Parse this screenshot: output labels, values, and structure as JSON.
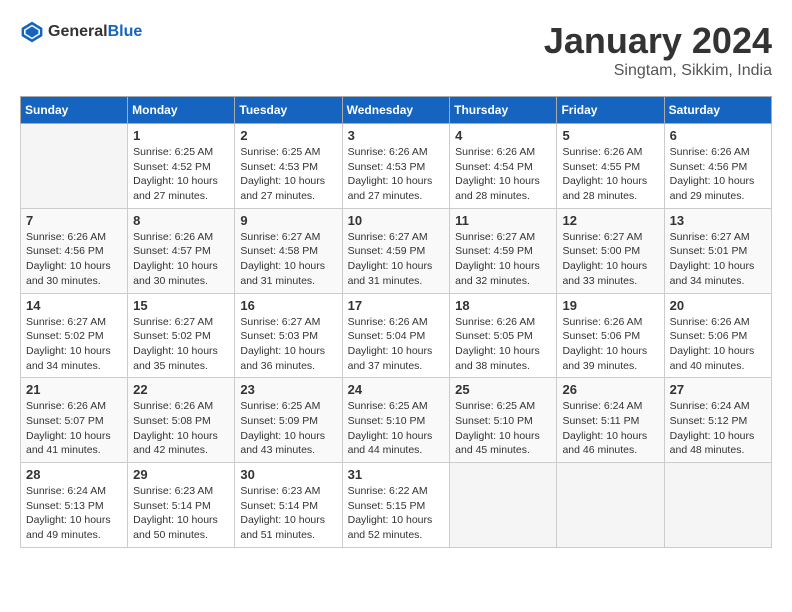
{
  "header": {
    "logo_general": "General",
    "logo_blue": "Blue",
    "month_year": "January 2024",
    "location": "Singtam, Sikkim, India"
  },
  "days_of_week": [
    "Sunday",
    "Monday",
    "Tuesday",
    "Wednesday",
    "Thursday",
    "Friday",
    "Saturday"
  ],
  "weeks": [
    [
      {
        "day": "",
        "info": ""
      },
      {
        "day": "1",
        "info": "Sunrise: 6:25 AM\nSunset: 4:52 PM\nDaylight: 10 hours\nand 27 minutes."
      },
      {
        "day": "2",
        "info": "Sunrise: 6:25 AM\nSunset: 4:53 PM\nDaylight: 10 hours\nand 27 minutes."
      },
      {
        "day": "3",
        "info": "Sunrise: 6:26 AM\nSunset: 4:53 PM\nDaylight: 10 hours\nand 27 minutes."
      },
      {
        "day": "4",
        "info": "Sunrise: 6:26 AM\nSunset: 4:54 PM\nDaylight: 10 hours\nand 28 minutes."
      },
      {
        "day": "5",
        "info": "Sunrise: 6:26 AM\nSunset: 4:55 PM\nDaylight: 10 hours\nand 28 minutes."
      },
      {
        "day": "6",
        "info": "Sunrise: 6:26 AM\nSunset: 4:56 PM\nDaylight: 10 hours\nand 29 minutes."
      }
    ],
    [
      {
        "day": "7",
        "info": "Sunrise: 6:26 AM\nSunset: 4:56 PM\nDaylight: 10 hours\nand 30 minutes."
      },
      {
        "day": "8",
        "info": "Sunrise: 6:26 AM\nSunset: 4:57 PM\nDaylight: 10 hours\nand 30 minutes."
      },
      {
        "day": "9",
        "info": "Sunrise: 6:27 AM\nSunset: 4:58 PM\nDaylight: 10 hours\nand 31 minutes."
      },
      {
        "day": "10",
        "info": "Sunrise: 6:27 AM\nSunset: 4:59 PM\nDaylight: 10 hours\nand 31 minutes."
      },
      {
        "day": "11",
        "info": "Sunrise: 6:27 AM\nSunset: 4:59 PM\nDaylight: 10 hours\nand 32 minutes."
      },
      {
        "day": "12",
        "info": "Sunrise: 6:27 AM\nSunset: 5:00 PM\nDaylight: 10 hours\nand 33 minutes."
      },
      {
        "day": "13",
        "info": "Sunrise: 6:27 AM\nSunset: 5:01 PM\nDaylight: 10 hours\nand 34 minutes."
      }
    ],
    [
      {
        "day": "14",
        "info": "Sunrise: 6:27 AM\nSunset: 5:02 PM\nDaylight: 10 hours\nand 34 minutes."
      },
      {
        "day": "15",
        "info": "Sunrise: 6:27 AM\nSunset: 5:02 PM\nDaylight: 10 hours\nand 35 minutes."
      },
      {
        "day": "16",
        "info": "Sunrise: 6:27 AM\nSunset: 5:03 PM\nDaylight: 10 hours\nand 36 minutes."
      },
      {
        "day": "17",
        "info": "Sunrise: 6:26 AM\nSunset: 5:04 PM\nDaylight: 10 hours\nand 37 minutes."
      },
      {
        "day": "18",
        "info": "Sunrise: 6:26 AM\nSunset: 5:05 PM\nDaylight: 10 hours\nand 38 minutes."
      },
      {
        "day": "19",
        "info": "Sunrise: 6:26 AM\nSunset: 5:06 PM\nDaylight: 10 hours\nand 39 minutes."
      },
      {
        "day": "20",
        "info": "Sunrise: 6:26 AM\nSunset: 5:06 PM\nDaylight: 10 hours\nand 40 minutes."
      }
    ],
    [
      {
        "day": "21",
        "info": "Sunrise: 6:26 AM\nSunset: 5:07 PM\nDaylight: 10 hours\nand 41 minutes."
      },
      {
        "day": "22",
        "info": "Sunrise: 6:26 AM\nSunset: 5:08 PM\nDaylight: 10 hours\nand 42 minutes."
      },
      {
        "day": "23",
        "info": "Sunrise: 6:25 AM\nSunset: 5:09 PM\nDaylight: 10 hours\nand 43 minutes."
      },
      {
        "day": "24",
        "info": "Sunrise: 6:25 AM\nSunset: 5:10 PM\nDaylight: 10 hours\nand 44 minutes."
      },
      {
        "day": "25",
        "info": "Sunrise: 6:25 AM\nSunset: 5:10 PM\nDaylight: 10 hours\nand 45 minutes."
      },
      {
        "day": "26",
        "info": "Sunrise: 6:24 AM\nSunset: 5:11 PM\nDaylight: 10 hours\nand 46 minutes."
      },
      {
        "day": "27",
        "info": "Sunrise: 6:24 AM\nSunset: 5:12 PM\nDaylight: 10 hours\nand 48 minutes."
      }
    ],
    [
      {
        "day": "28",
        "info": "Sunrise: 6:24 AM\nSunset: 5:13 PM\nDaylight: 10 hours\nand 49 minutes."
      },
      {
        "day": "29",
        "info": "Sunrise: 6:23 AM\nSunset: 5:14 PM\nDaylight: 10 hours\nand 50 minutes."
      },
      {
        "day": "30",
        "info": "Sunrise: 6:23 AM\nSunset: 5:14 PM\nDaylight: 10 hours\nand 51 minutes."
      },
      {
        "day": "31",
        "info": "Sunrise: 6:22 AM\nSunset: 5:15 PM\nDaylight: 10 hours\nand 52 minutes."
      },
      {
        "day": "",
        "info": ""
      },
      {
        "day": "",
        "info": ""
      },
      {
        "day": "",
        "info": ""
      }
    ]
  ]
}
